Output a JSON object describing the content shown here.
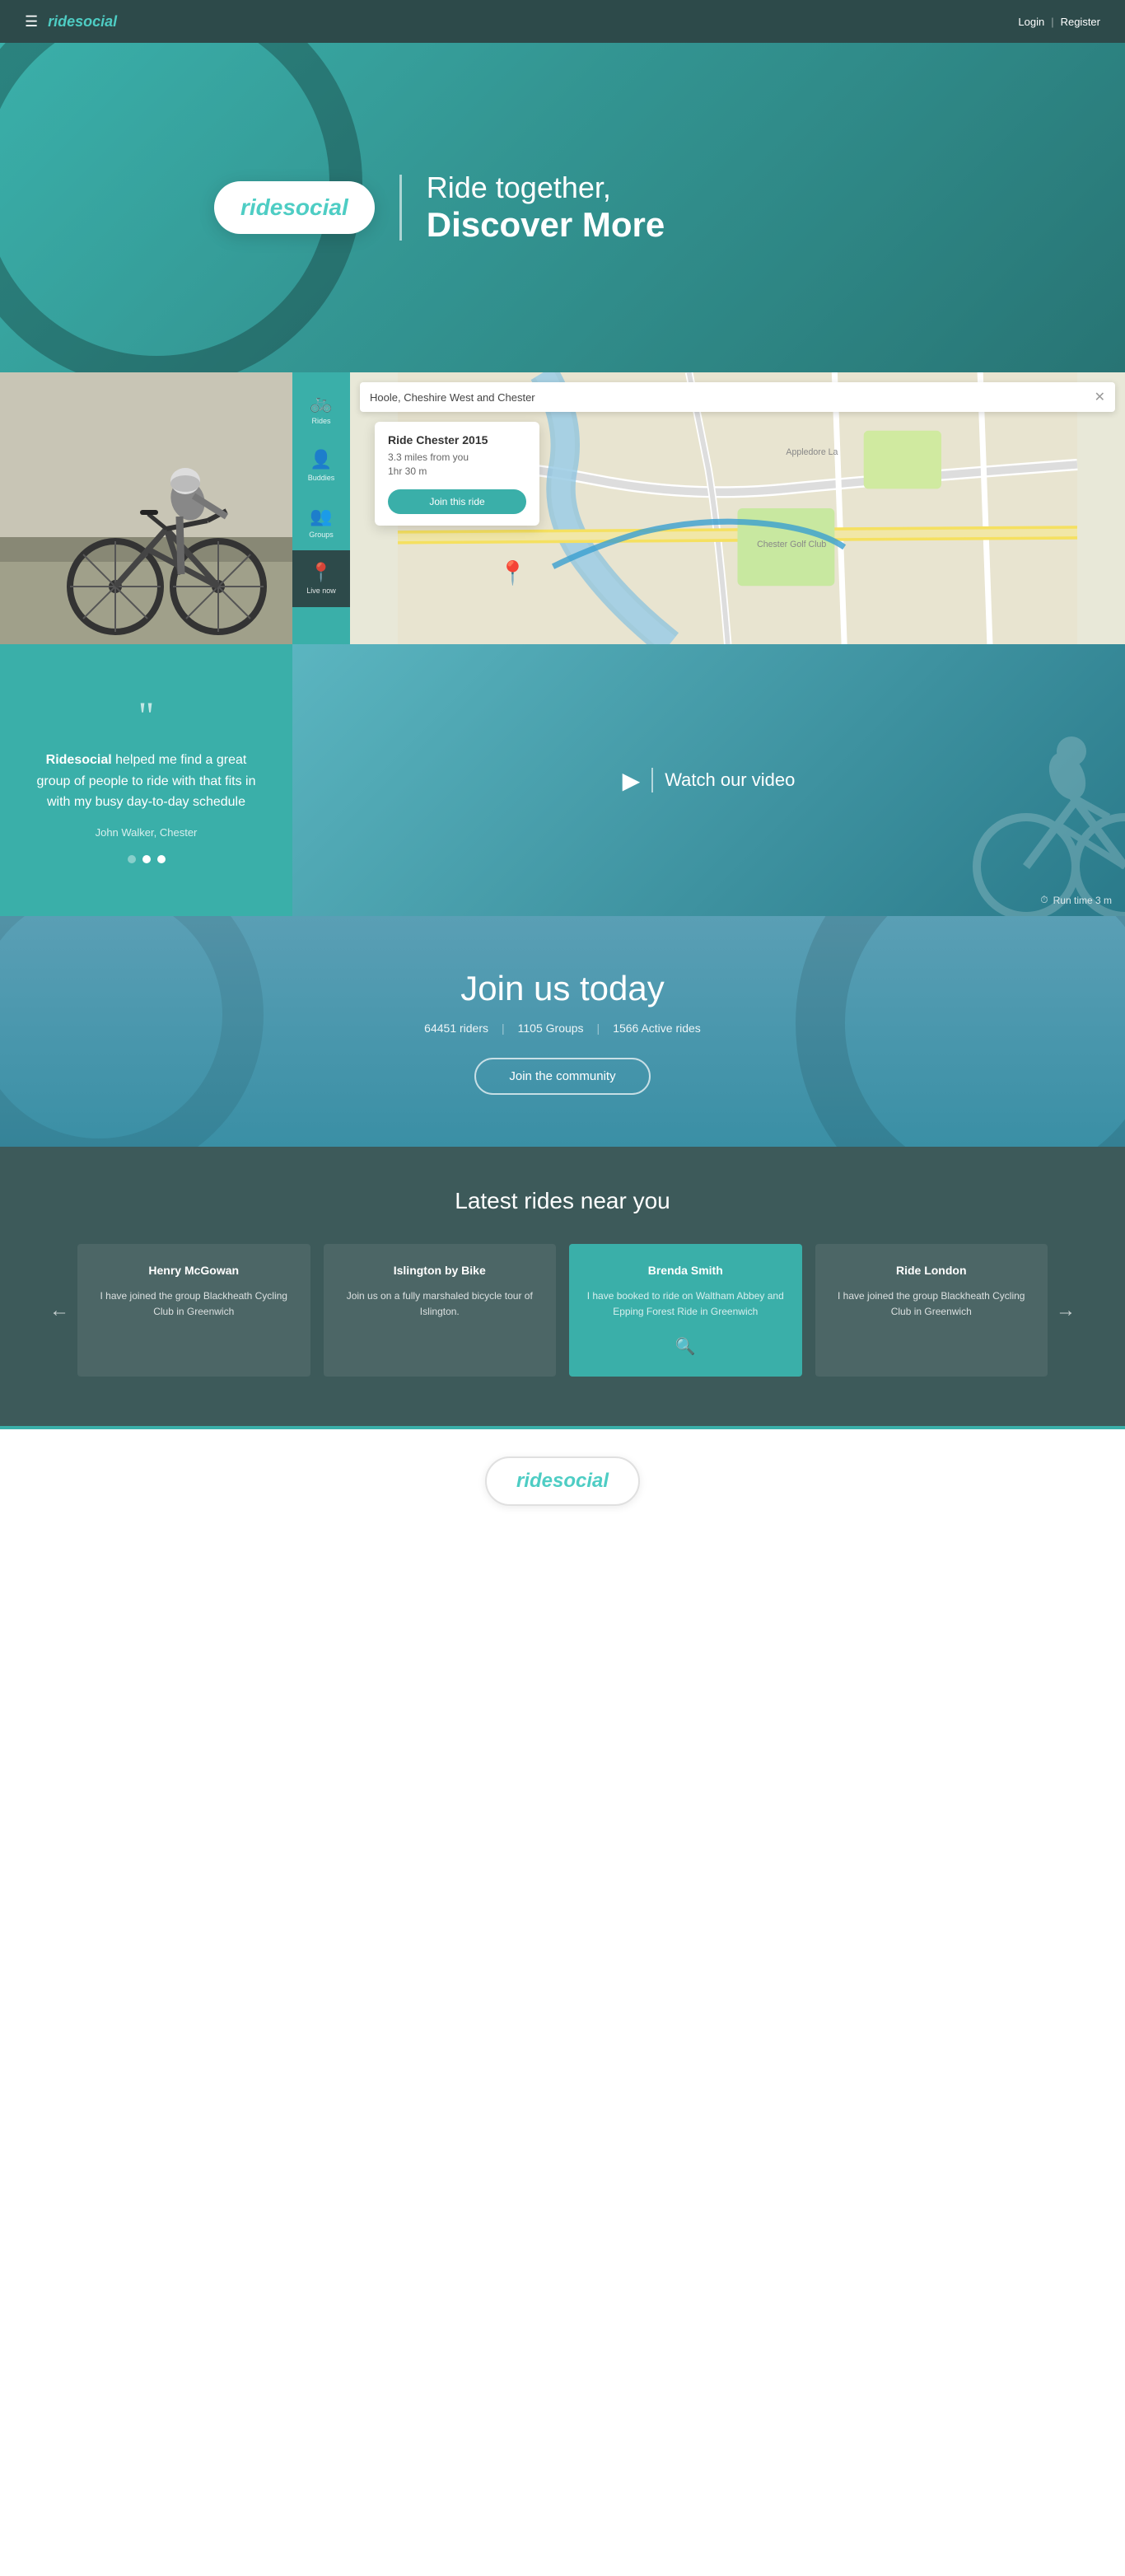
{
  "navbar": {
    "brand": "ridesocial",
    "login": "Login",
    "divider": "|",
    "register": "Register"
  },
  "hero": {
    "logo": "ridesocial",
    "tagline1": "Ride together,",
    "tagline2": "Discover More"
  },
  "sidebar": {
    "items": [
      {
        "icon": "🚲",
        "label": "Rides"
      },
      {
        "icon": "👤",
        "label": "Buddies"
      },
      {
        "icon": "👥",
        "label": "Groups"
      },
      {
        "icon": "📍",
        "label": "Live now"
      }
    ]
  },
  "map": {
    "search_placeholder": "Hoole, Cheshire West and Chester",
    "ride": {
      "title": "Ride Chester 2015",
      "distance": "3.3 miles from you",
      "duration": "1hr 30 m",
      "join_btn": "Join this ride"
    }
  },
  "testimonial": {
    "quote": "Ridesocial helped me find a great group of people to ride with that fits in with my busy day-to-day schedule",
    "brand_highlight": "Ridesocial",
    "author": "John Walker, Chester",
    "dots": [
      false,
      true,
      true
    ]
  },
  "video": {
    "cta": "Watch our video",
    "runtime": "Run time 3 m"
  },
  "join_section": {
    "title": "Join us today",
    "riders": "64451 riders",
    "groups": "1105 Groups",
    "active_rides": "1566 Active rides",
    "cta_btn": "Join the community"
  },
  "latest_rides": {
    "section_title": "Latest rides near you",
    "cards": [
      {
        "name": "Henry McGowan",
        "description": "I have joined the group Blackheath Cycling Club in Greenwich",
        "highlighted": false
      },
      {
        "name": "Islington by Bike",
        "description": "Join us on a fully marshaled bicycle tour of Islington.",
        "highlighted": false
      },
      {
        "name": "Brenda Smith",
        "description": "I have booked to ride on Waltham Abbey and Epping Forest Ride in Greenwich",
        "highlighted": true
      },
      {
        "name": "Ride London",
        "description": "I have joined the group Blackheath Cycling Club in Greenwich",
        "highlighted": false
      }
    ],
    "prev_arrow": "←",
    "next_arrow": "→"
  },
  "footer": {
    "logo": "ridesocial"
  }
}
